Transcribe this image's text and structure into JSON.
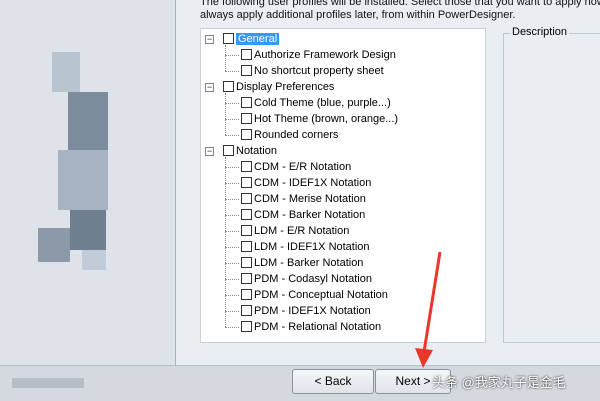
{
  "intro": {
    "line1": "The following user profiles will be installed. Select those that you want to apply now. You",
    "line2": "always apply additional profiles later, from within PowerDesigner."
  },
  "tree": {
    "groups": [
      {
        "label": "General",
        "expander": "−",
        "selected": true,
        "items": [
          "Authorize Framework Design",
          "No shortcut property sheet"
        ]
      },
      {
        "label": "Display Preferences",
        "expander": "−",
        "selected": false,
        "items": [
          "Cold Theme (blue, purple...)",
          "Hot Theme (brown, orange...)",
          "Rounded corners"
        ]
      },
      {
        "label": "Notation",
        "expander": "−",
        "selected": false,
        "items": [
          "CDM - E/R Notation",
          "CDM - IDEF1X Notation",
          "CDM - Merise Notation",
          "CDM - Barker Notation",
          "LDM - E/R Notation",
          "LDM - IDEF1X Notation",
          "LDM - Barker Notation",
          "PDM - Codasyl Notation",
          "PDM - Conceptual Notation",
          "PDM - IDEF1X Notation",
          "PDM - Relational Notation"
        ]
      }
    ]
  },
  "description": {
    "title": "Description"
  },
  "buttons": {
    "back": "< Back",
    "next": "Next >"
  },
  "watermark": "头条 @我家丸子是金毛",
  "colors": {
    "selection": "#3399ff",
    "arrow": "#e8372b"
  }
}
